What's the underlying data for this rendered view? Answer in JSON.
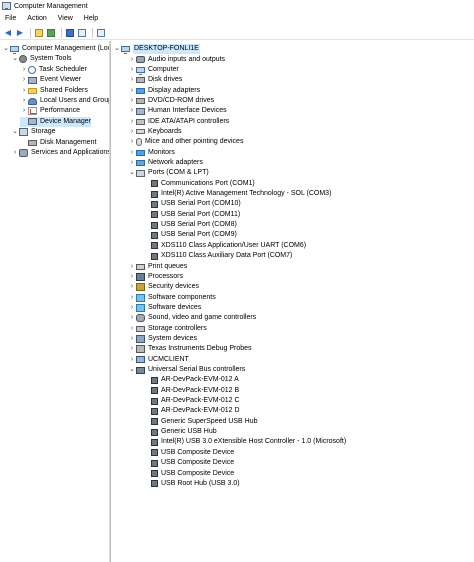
{
  "window": {
    "title": "Computer Management"
  },
  "menu": [
    "File",
    "Action",
    "View",
    "Help"
  ],
  "toolbar": {
    "icons": [
      "back-arrow-icon",
      "forward-arrow-icon",
      "up-folder-icon",
      "show-hide-tree-icon",
      "help-icon",
      "properties-icon",
      "show-console-icon"
    ]
  },
  "left_tree": [
    {
      "label": "Computer Management (Local",
      "icon": "computer-icon",
      "exp": "chevron-down",
      "level": 0
    },
    {
      "label": "System Tools",
      "icon": "tools-icon",
      "exp": "chevron-down",
      "level": 1
    },
    {
      "label": "Task Scheduler",
      "icon": "clock-icon",
      "exp": "chevron-right",
      "level": 2
    },
    {
      "label": "Event Viewer",
      "icon": "event-viewer-icon",
      "exp": "chevron-right",
      "level": 2
    },
    {
      "label": "Shared Folders",
      "icon": "folder-icon",
      "exp": "chevron-right",
      "level": 2
    },
    {
      "label": "Local Users and Groups",
      "icon": "users-icon",
      "exp": "chevron-right",
      "level": 2
    },
    {
      "label": "Performance",
      "icon": "performance-icon",
      "exp": "chevron-right",
      "level": 2
    },
    {
      "label": "Device Manager",
      "icon": "device-manager-icon",
      "exp": "",
      "level": 2,
      "selected": true
    },
    {
      "label": "Storage",
      "icon": "storage-icon",
      "exp": "chevron-down",
      "level": 1
    },
    {
      "label": "Disk Management",
      "icon": "disk-icon",
      "exp": "",
      "level": 2
    },
    {
      "label": "Services and Applications",
      "icon": "services-icon",
      "exp": "chevron-right",
      "level": 1
    }
  ],
  "device_tree": {
    "root": "DESKTOP-FONLI1E",
    "items": [
      {
        "label": "Audio inputs and outputs",
        "icon": "audio-icon",
        "exp": "chevron-right",
        "level": 1
      },
      {
        "label": "Computer",
        "icon": "computer-icon",
        "exp": "chevron-right",
        "level": 1
      },
      {
        "label": "Disk drives",
        "icon": "disk-drive-icon",
        "exp": "chevron-right",
        "level": 1
      },
      {
        "label": "Display adapters",
        "icon": "display-adapter-icon",
        "exp": "chevron-right",
        "level": 1
      },
      {
        "label": "DVD/CD-ROM drives",
        "icon": "dvd-icon",
        "exp": "chevron-right",
        "level": 1
      },
      {
        "label": "Human Interface Devices",
        "icon": "hid-icon",
        "exp": "chevron-right",
        "level": 1
      },
      {
        "label": "IDE ATA/ATAPI controllers",
        "icon": "ide-icon",
        "exp": "chevron-right",
        "level": 1
      },
      {
        "label": "Keyboards",
        "icon": "keyboard-icon",
        "exp": "chevron-right",
        "level": 1
      },
      {
        "label": "Mice and other pointing devices",
        "icon": "mouse-icon",
        "exp": "chevron-right",
        "level": 1
      },
      {
        "label": "Monitors",
        "icon": "monitor-icon",
        "exp": "chevron-right",
        "level": 1
      },
      {
        "label": "Network adapters",
        "icon": "network-icon",
        "exp": "chevron-right",
        "level": 1
      },
      {
        "label": "Ports (COM & LPT)",
        "icon": "port-icon",
        "exp": "chevron-down",
        "level": 1
      },
      {
        "label": "Communications Port (COM1)",
        "icon": "port-device-icon",
        "exp": "",
        "level": 2
      },
      {
        "label": "Intel(R) Active Management Technology - SOL (COM3)",
        "icon": "port-device-icon",
        "exp": "",
        "level": 2
      },
      {
        "label": "USB Serial Port (COM10)",
        "icon": "port-device-icon",
        "exp": "",
        "level": 2
      },
      {
        "label": "USB Serial Port (COM11)",
        "icon": "port-device-icon",
        "exp": "",
        "level": 2
      },
      {
        "label": "USB Serial Port (COM8)",
        "icon": "port-device-icon",
        "exp": "",
        "level": 2
      },
      {
        "label": "USB Serial Port (COM9)",
        "icon": "port-device-icon",
        "exp": "",
        "level": 2
      },
      {
        "label": "XDS110 Class Application/User UART (COM6)",
        "icon": "port-device-icon",
        "exp": "",
        "level": 2
      },
      {
        "label": "XDS110 Class Auxiliary Data Port (COM7)",
        "icon": "port-device-icon",
        "exp": "",
        "level": 2
      },
      {
        "label": "Print queues",
        "icon": "printer-icon",
        "exp": "chevron-right",
        "level": 1
      },
      {
        "label": "Processors",
        "icon": "processor-icon",
        "exp": "chevron-right",
        "level": 1
      },
      {
        "label": "Security devices",
        "icon": "security-icon",
        "exp": "chevron-right",
        "level": 1
      },
      {
        "label": "Software components",
        "icon": "software-icon",
        "exp": "chevron-right",
        "level": 1
      },
      {
        "label": "Software devices",
        "icon": "software-icon",
        "exp": "chevron-right",
        "level": 1
      },
      {
        "label": "Sound, video and game controllers",
        "icon": "sound-icon",
        "exp": "chevron-right",
        "level": 1
      },
      {
        "label": "Storage controllers",
        "icon": "storage-controller-icon",
        "exp": "chevron-right",
        "level": 1
      },
      {
        "label": "System devices",
        "icon": "system-icon",
        "exp": "chevron-right",
        "level": 1
      },
      {
        "label": "Texas Instruments Debug Probes",
        "icon": "debug-probe-icon",
        "exp": "chevron-right",
        "level": 1
      },
      {
        "label": "UCMCLIENT",
        "icon": "ucm-icon",
        "exp": "chevron-right",
        "level": 1
      },
      {
        "label": "Universal Serial Bus controllers",
        "icon": "usb-icon",
        "exp": "chevron-down",
        "level": 1
      },
      {
        "label": "AR-DevPack-EVM-012 A",
        "icon": "usb-device-icon",
        "exp": "",
        "level": 2
      },
      {
        "label": "AR-DevPack-EVM-012 B",
        "icon": "usb-device-icon",
        "exp": "",
        "level": 2
      },
      {
        "label": "AR-DevPack-EVM-012 C",
        "icon": "usb-device-icon",
        "exp": "",
        "level": 2
      },
      {
        "label": "AR-DevPack-EVM-012 D",
        "icon": "usb-device-icon",
        "exp": "",
        "level": 2
      },
      {
        "label": "Generic SuperSpeed USB Hub",
        "icon": "usb-device-icon",
        "exp": "",
        "level": 2
      },
      {
        "label": "Generic USB Hub",
        "icon": "usb-device-icon",
        "exp": "",
        "level": 2
      },
      {
        "label": "Intel(R) USB 3.0 eXtensible Host Controller - 1.0 (Microsoft)",
        "icon": "usb-device-icon",
        "exp": "",
        "level": 2
      },
      {
        "label": "USB Composite Device",
        "icon": "usb-device-icon",
        "exp": "",
        "level": 2
      },
      {
        "label": "USB Composite Device",
        "icon": "usb-device-icon",
        "exp": "",
        "level": 2
      },
      {
        "label": "USB Composite Device",
        "icon": "usb-device-icon",
        "exp": "",
        "level": 2
      },
      {
        "label": "USB Root Hub (USB 3.0)",
        "icon": "usb-device-icon",
        "exp": "",
        "level": 2
      }
    ]
  }
}
